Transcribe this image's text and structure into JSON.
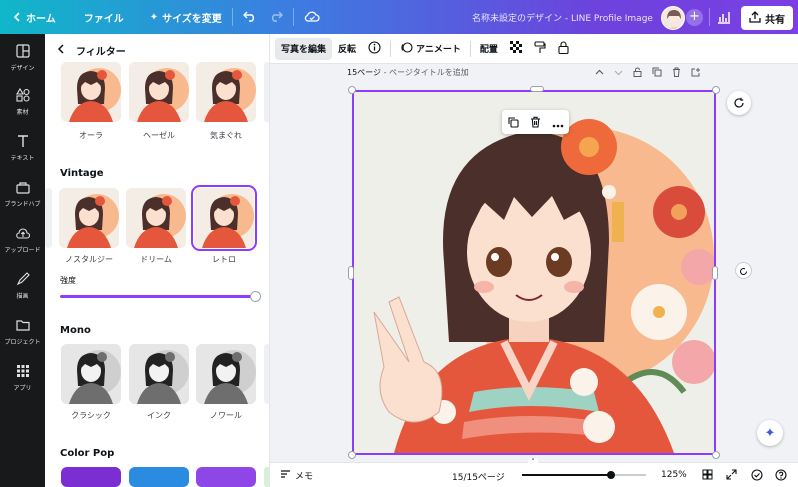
{
  "topbar": {
    "home": "ホーム",
    "file": "ファイル",
    "resize": "サイズを変更",
    "doc_title": "名称未設定のデザイン - LINE Profile Image",
    "share": "共有"
  },
  "rail": [
    {
      "label": "デザイン",
      "icon": "layout-icon"
    },
    {
      "label": "素材",
      "icon": "elements-icon"
    },
    {
      "label": "テキスト",
      "icon": "text-icon"
    },
    {
      "label": "ブランドハブ",
      "icon": "brand-icon"
    },
    {
      "label": "アップロード",
      "icon": "upload-icon"
    },
    {
      "label": "描画",
      "icon": "draw-icon"
    },
    {
      "label": "プロジェクト",
      "icon": "folder-icon"
    },
    {
      "label": "アプリ",
      "icon": "apps-icon"
    }
  ],
  "panel": {
    "title": "フィルター",
    "top_row": [
      "オーラ",
      "ヘーゼル",
      "気まぐれ"
    ],
    "vintage": {
      "title": "Vintage",
      "items": [
        "ノスタルジー",
        "ドリーム",
        "レトロ"
      ],
      "selected": "レトロ"
    },
    "intensity": {
      "label": "強度",
      "value": 1.0
    },
    "mono": {
      "title": "Mono",
      "items": [
        "クラシック",
        "インク",
        "ノワール"
      ]
    },
    "colorpop": {
      "title": "Color Pop"
    }
  },
  "context": {
    "edit_photo": "写真を編集",
    "flip": "反転",
    "animate": "アニメート",
    "position": "配置"
  },
  "page": {
    "label": "15ページ",
    "title_placeholder": "ページタイトルを追加"
  },
  "bottom": {
    "notes": "メモ",
    "page_counter": "15/15ページ",
    "zoom": "125%",
    "zoom_fraction": 0.72
  },
  "colors": {
    "accent": "#8b3dff",
    "kimono": "#e4573d",
    "sun": "#f7b98d"
  }
}
